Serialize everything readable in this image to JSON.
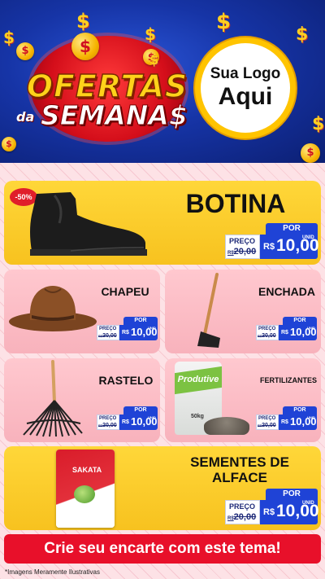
{
  "header": {
    "title_line1": "OFERTAS",
    "title_da": "da",
    "title_line2": "SEMANA$",
    "coin_symbol": "$",
    "logo_line1": "Sua Logo",
    "logo_line2": "Aqui",
    "colors": {
      "blue": "#1634a6",
      "red": "#d40e1a",
      "gold": "#ffd21a"
    }
  },
  "products": [
    {
      "name": "BOTINA",
      "discount": "-50%",
      "por": "POR",
      "preco_label": "PREÇO",
      "old_currency": "R$",
      "old_price": "20,00",
      "currency": "R$",
      "price": "10,00",
      "unit": "UNID",
      "icon": "boot-icon"
    },
    {
      "name": "CHAPEU",
      "por": "POR",
      "preco_label": "PREÇO",
      "old_currency": "R$",
      "old_price": "20,00",
      "currency": "R$",
      "price": "10,00",
      "unit": "UNID",
      "icon": "hat-icon"
    },
    {
      "name": "ENCHADA",
      "por": "POR",
      "preco_label": "PREÇO",
      "old_currency": "R$",
      "old_price": "20,00",
      "currency": "R$",
      "price": "10,00",
      "unit": "UNID",
      "icon": "hoe-icon"
    },
    {
      "name": "RASTELO",
      "por": "POR",
      "preco_label": "PREÇO",
      "old_currency": "R$",
      "old_price": "20,00",
      "currency": "R$",
      "price": "10,00",
      "unit": "UNID",
      "icon": "rake-icon"
    },
    {
      "name": "FERTILIZANTES",
      "por": "POR",
      "preco_label": "PREÇO",
      "old_currency": "R$",
      "old_price": "20,00",
      "currency": "R$",
      "price": "10,00",
      "unit": "UNID",
      "icon": "fertilizer-bag-icon",
      "bag_brand": "Produtive",
      "bag_weight": "50kg"
    },
    {
      "name_line1": "SEMENTES DE",
      "name_line2": "ALFACE",
      "por": "POR",
      "preco_label": "PREÇO",
      "old_currency": "R$",
      "old_price": "20,00",
      "currency": "R$",
      "price": "10,00",
      "unit": "UNID",
      "icon": "seed-packet-icon",
      "packet_brand": "SAKATA"
    }
  ],
  "cta": "Crie seu encarte com este tema!",
  "disclaimer": "*Imagens Meramente Ilustrativas"
}
